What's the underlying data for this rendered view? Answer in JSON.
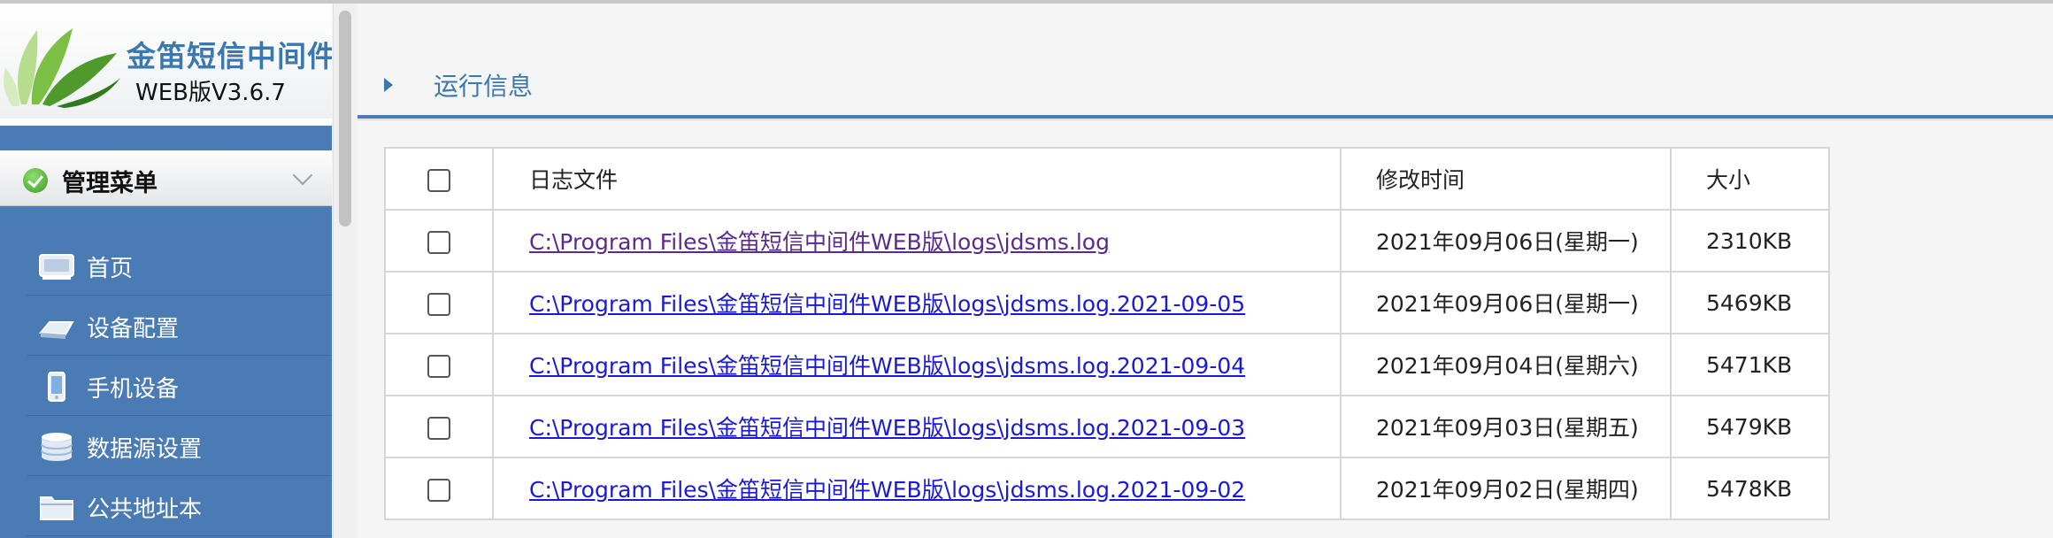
{
  "brand": {
    "title": "金笛短信中间件",
    "version": "WEB版V3.6.7"
  },
  "menu": {
    "title": "管理菜单",
    "items": [
      {
        "label": "首页",
        "icon": "monitor-icon"
      },
      {
        "label": "设备配置",
        "icon": "device-config-icon"
      },
      {
        "label": "手机设备",
        "icon": "mobile-phone-icon"
      },
      {
        "label": "数据源设置",
        "icon": "database-icon"
      },
      {
        "label": "公共地址本",
        "icon": "folder-icon"
      }
    ]
  },
  "section": {
    "title": "运行信息"
  },
  "table": {
    "headers": {
      "file": "日志文件",
      "time": "修改时间",
      "size": "大小"
    },
    "rows": [
      {
        "file": "C:\\Program Files\\金笛短信中间件WEB版\\logs\\jdsms.log",
        "time": "2021年09月06日(星期一)",
        "size": "2310KB"
      },
      {
        "file": "C:\\Program Files\\金笛短信中间件WEB版\\logs\\jdsms.log.2021-09-05",
        "time": "2021年09月06日(星期一)",
        "size": "5469KB"
      },
      {
        "file": "C:\\Program Files\\金笛短信中间件WEB版\\logs\\jdsms.log.2021-09-04",
        "time": "2021年09月04日(星期六)",
        "size": "5471KB"
      },
      {
        "file": "C:\\Program Files\\金笛短信中间件WEB版\\logs\\jdsms.log.2021-09-03",
        "time": "2021年09月03日(星期五)",
        "size": "5479KB"
      },
      {
        "file": "C:\\Program Files\\金笛短信中间件WEB版\\logs\\jdsms.log.2021-09-02",
        "time": "2021年09月02日(星期四)",
        "size": "5478KB"
      }
    ]
  },
  "colors": {
    "sidebar": "#4a7bb4",
    "accent": "#3c78b0",
    "link": "#1a1ad6",
    "visited_link": "#5a2a8c"
  }
}
